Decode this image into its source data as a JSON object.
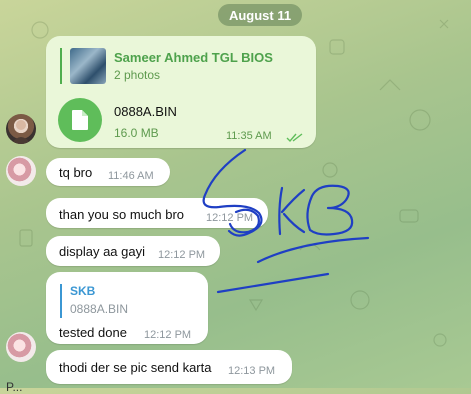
{
  "date_label": "August 11",
  "colors": {
    "outgoing_bubble": "#eaf7d9",
    "incoming_bubble": "#ffffff",
    "accent_green": "#4ea24c",
    "reply_blue": "#3b97d3",
    "ink_blue": "#1f3fc4"
  },
  "forwarded": {
    "title": "Sameer Ahmed TGL BIOS",
    "subtitle": "2 photos",
    "file_name": "0888A.BIN",
    "file_size": "16.0 MB",
    "time": "11:35 AM",
    "file_icon": "document-icon",
    "status_icon": "double-check-icon"
  },
  "messages": [
    {
      "text": "tq bro",
      "time": "11:46 AM"
    },
    {
      "text": "than you so much bro",
      "time": "12:12 PM"
    },
    {
      "text": "display aa gayi",
      "time": "12:12 PM"
    },
    {
      "reply_name": "SKB",
      "reply_text": "0888A.BIN",
      "text": "tested done",
      "time": "12:12 PM"
    },
    {
      "text": "thodi der se pic send karta",
      "time": "12:13 PM"
    }
  ],
  "bottom_text": "P..."
}
